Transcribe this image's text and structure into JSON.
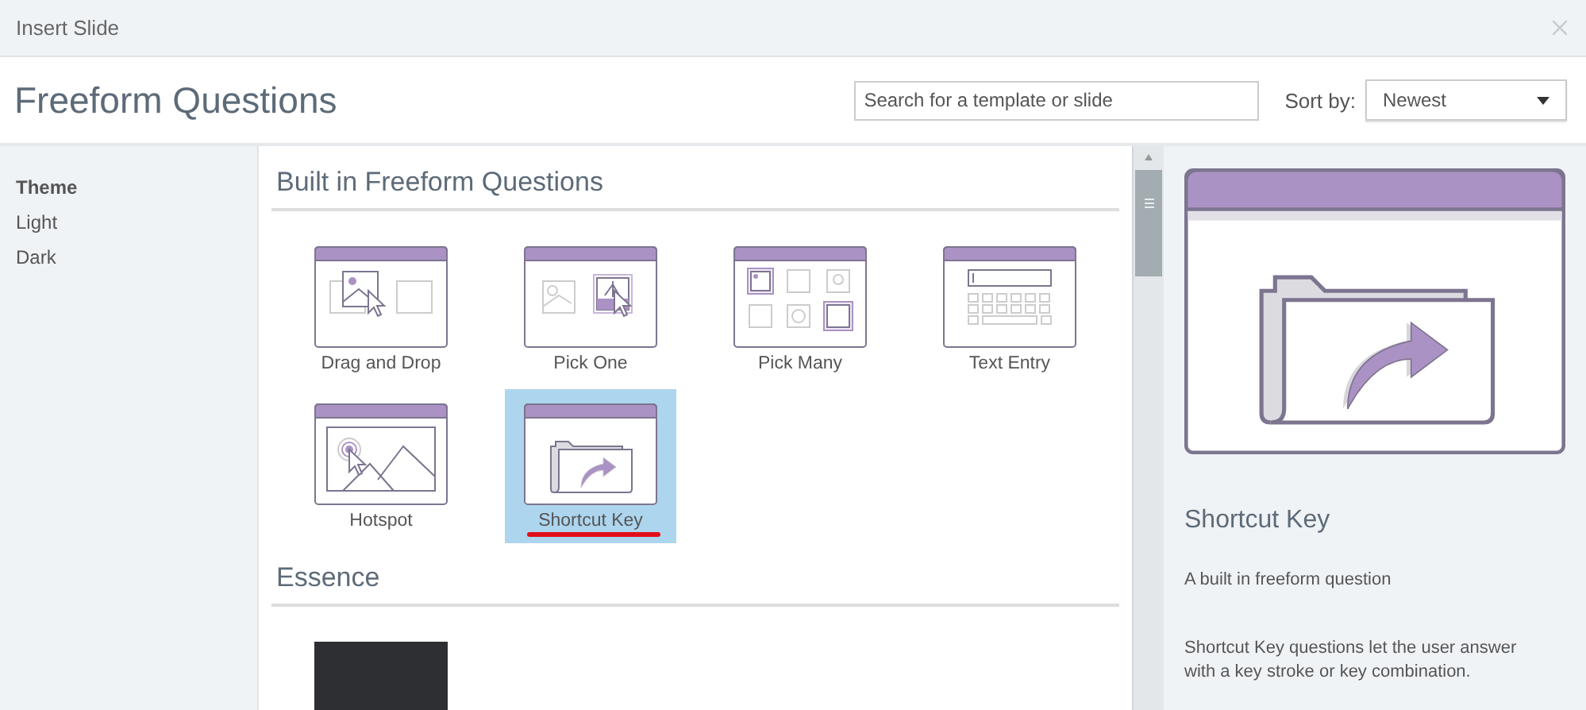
{
  "window": {
    "title": "Insert Slide"
  },
  "header": {
    "title": "Freeform Questions",
    "search": {
      "placeholder": "Search for a template or slide"
    },
    "sort": {
      "label": "Sort by:",
      "value": "Newest"
    }
  },
  "sidebar": {
    "heading": "Theme",
    "items": [
      {
        "label": "Light"
      },
      {
        "label": "Dark"
      }
    ]
  },
  "sections": [
    {
      "title": "Built in Freeform Questions",
      "tiles": [
        {
          "kind": "drag_drop",
          "label": "Drag and Drop",
          "selected": false
        },
        {
          "kind": "pick_one",
          "label": "Pick One",
          "selected": false
        },
        {
          "kind": "pick_many",
          "label": "Pick Many",
          "selected": false
        },
        {
          "kind": "text_entry",
          "label": "Text Entry",
          "selected": false
        },
        {
          "kind": "hotspot",
          "label": "Hotspot",
          "selected": false
        },
        {
          "kind": "shortcut_key",
          "label": "Shortcut Key",
          "selected": true
        }
      ]
    },
    {
      "title": "Essence",
      "tiles": [
        {
          "kind": "slide_thumbnail",
          "selected": false
        }
      ]
    }
  ],
  "preview": {
    "kind": "shortcut_key",
    "title": "Shortcut Key",
    "subtitle": "A built in freeform question",
    "description": "Shortcut Key questions let the user answer with a key stroke or key combination."
  }
}
